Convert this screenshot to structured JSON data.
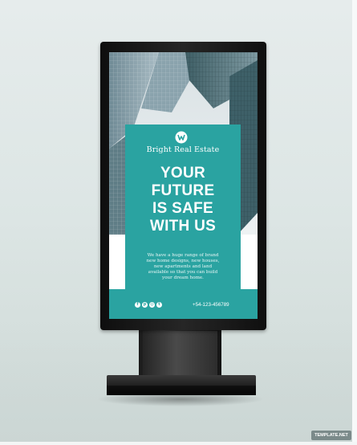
{
  "poster": {
    "brand": "Bright Real Estate",
    "headline": [
      "YOUR",
      "FUTURE",
      "IS SAFE",
      "WITH US"
    ],
    "body_lines": [
      "We have a huge range of brand",
      "new home designs, new houses,",
      "new apartments and land",
      "available so that you can build",
      "your dream home."
    ],
    "phone": "+54-123-456789",
    "social_icons": [
      "facebook-icon",
      "pinterest-icon",
      "instagram-icon",
      "twitter-icon"
    ],
    "accent_color": "#2aa3a1"
  },
  "watermark": "TEMPLATE.NET"
}
